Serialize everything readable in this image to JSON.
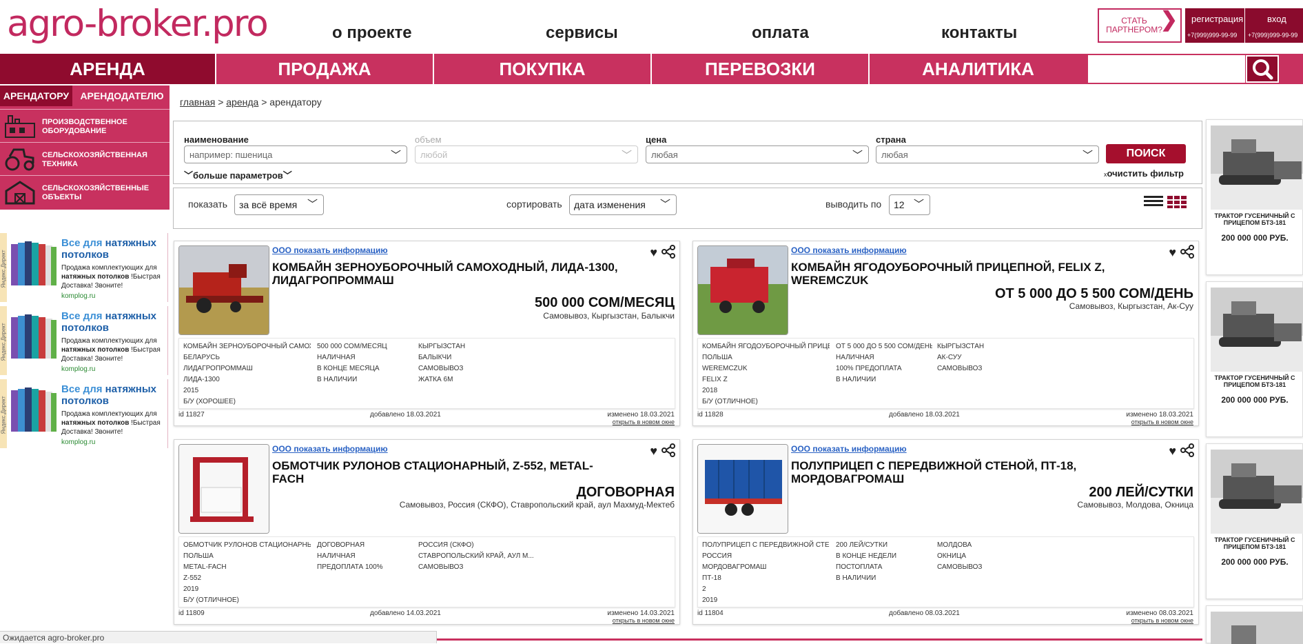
{
  "logo": "agro-broker.pro",
  "topnav": [
    "о проекте",
    "сервисы",
    "оплата",
    "контакты"
  ],
  "partner": {
    "line1": "СТАТЬ",
    "line2": "ПАРТНЕРОМ?",
    "arrow": "❯"
  },
  "auth": {
    "register": "регистрация",
    "login": "вход",
    "phone1": "+7(999)999-99-99",
    "phone2": "+7(999)999-99-99"
  },
  "mainnav": [
    "АРЕНДА",
    "ПРОДАЖА",
    "ПОКУПКА",
    "ПЕРЕВОЗКИ",
    "АНАЛИТИКА"
  ],
  "sidebar": {
    "tabs": [
      "АРЕНДАТОРУ",
      "АРЕНДОДАТЕЛЮ"
    ],
    "items": [
      {
        "l1": "ПРОИЗВОДСТВЕННОЕ",
        "l2": "ОБОРУДОВАНИЕ",
        "icon": "factory-icon"
      },
      {
        "l1": "СЕЛЬСКОХОЗЯЙСТВЕННАЯ",
        "l2": "ТЕХНИКА",
        "icon": "tractor-icon"
      },
      {
        "l1": "СЕЛЬСКОХОЗЯЙСТВЕННЫЕ",
        "l2": "ОБЪЕКТЫ",
        "icon": "barn-icon"
      }
    ]
  },
  "ads": [
    {
      "label": "Яндекс.Директ",
      "t1": "Все для ",
      "t2": "натяжных потолков",
      "d1": "Продажа комплектующих для ",
      "d2": "натяжных потолков",
      "d3": " !Быстрая Доставка! Звоните!",
      "url": "komplog.ru"
    },
    {
      "label": "Яндекс.Директ",
      "t1": "Все для ",
      "t2": "натяжных потолков",
      "d1": "Продажа комплектующих для ",
      "d2": "натяжных потолков",
      "d3": " !Быстрая Доставка! Звоните!",
      "url": "komplog.ru"
    },
    {
      "label": "Яндекс.Директ",
      "t1": "Все для ",
      "t2": "натяжных потолков",
      "d1": "Продажа комплектующих для ",
      "d2": "натяжных потолков",
      "d3": " !Быстрая Доставка! Звоните!",
      "url": "komplog.ru"
    }
  ],
  "breadcrumb": {
    "home": "главная",
    "section": "аренда",
    "current": "арендатору",
    "sep": ">"
  },
  "filter": {
    "name_label": "наименование",
    "name_placeholder": "например: пшеница",
    "volume_label": "объем",
    "volume_value": "любой",
    "price_label": "цена",
    "price_value": "любая",
    "country_label": "страна",
    "country_value": "любая",
    "search": "ПОИСК",
    "more": "больше параметров",
    "clear_x": "x",
    "clear": "очистить фильтр"
  },
  "sortbar": {
    "show_label": "показать",
    "show_value": "за всё время",
    "sort_label": "сортировать",
    "sort_value": "дата изменения",
    "perpage_label": "выводить по",
    "perpage_value": "12"
  },
  "cards": [
    {
      "org": "ООО показать информацию",
      "title": "КОМБАЙН ЗЕРНОУБОРОЧНЫЙ САМОХОДНЫЙ, ЛИДА-1300, ЛИДАГРОПРОММАШ",
      "price": "500 000 СОМ/МЕСЯЦ",
      "location": "Самовывоз, Кыргызстан, Балыкчи",
      "col1": [
        "КОМБАЙН ЗЕРНОУБОРОЧНЫЙ САМОХОДН...",
        "БЕЛАРУСЬ",
        "ЛИДАГРОПРОММАШ",
        "ЛИДА-1300",
        "2015",
        "Б/У (ХОРОШЕЕ)"
      ],
      "col2": [
        "500 000 СОМ/МЕСЯЦ",
        "НАЛИЧНАЯ",
        "В КОНЦЕ МЕСЯЦА",
        "В НАЛИЧИИ"
      ],
      "col3": [
        "КЫРГЫЗСТАН",
        "БАЛЫКЧИ",
        "САМОВЫВОЗ",
        "ЖАТКА 6М"
      ],
      "id": "id 11827",
      "added": "добавлено 18.03.2021",
      "changed": "изменено 18.03.2021",
      "newwin": "открыть в новом окне"
    },
    {
      "org": "ООО показать информацию",
      "title": "КОМБАЙН ЯГОДОУБОРОЧНЫЙ ПРИЦЕПНОЙ, FELIX Z, WEREMCZUK",
      "price": "ОТ 5 000 ДО 5 500 СОМ/ДЕНЬ",
      "location": "Самовывоз, Кыргызстан, Ак-Суу",
      "col1": [
        "КОМБАЙН ЯГОДОУБОРОЧНЫЙ ПРИЦЕПНОЙ",
        "ПОЛЬША",
        "WEREMCZUK",
        "FELIX Z",
        "2018",
        "Б/У (ОТЛИЧНОЕ)"
      ],
      "col2": [
        "ОТ 5 000 ДО 5 500 СОМ/ДЕНЬ",
        "НАЛИЧНАЯ",
        "100% ПРЕДОПЛАТА",
        "В НАЛИЧИИ"
      ],
      "col3": [
        "КЫРГЫЗСТАН",
        "АК-СУУ",
        "САМОВЫВОЗ"
      ],
      "id": "id 11828",
      "added": "добавлено 18.03.2021",
      "changed": "изменено 18.03.2021",
      "newwin": "открыть в новом окне"
    },
    {
      "org": "ООО показать информацию",
      "title": "ОБМОТЧИК РУЛОНОВ СТАЦИОНАРНЫЙ, Z-552, METAL-FACH",
      "price": "ДОГОВОРНАЯ",
      "location": "Самовывоз, Россия (СКФО), Ставропольский край, аул Махмуд-Мектеб",
      "col1": [
        "ОБМОТЧИК РУЛОНОВ СТАЦИОНАРНЫЙ",
        "ПОЛЬША",
        "METAL-FACH",
        "Z-552",
        "2019",
        "Б/У (ОТЛИЧНОЕ)"
      ],
      "col2": [
        "ДОГОВОРНАЯ",
        "НАЛИЧНАЯ",
        "ПРЕДОПЛАТА 100%"
      ],
      "col3": [
        "РОССИЯ (СКФО)",
        "СТАВРОПОЛЬСКИЙ КРАЙ, АУЛ М...",
        "САМОВЫВОЗ"
      ],
      "id": "id 11809",
      "added": "добавлено 14.03.2021",
      "changed": "изменено 14.03.2021",
      "newwin": "открыть в новом окне"
    },
    {
      "org": "ООО показать информацию",
      "title": "ПОЛУПРИЦЕП С ПЕРЕДВИЖНОЙ СТЕНОЙ, ПТ-18, МОРДОВАГРОМАШ",
      "price": "200 ЛЕЙ/СУТКИ",
      "location": "Самовывоз, Молдова, Окница",
      "col1": [
        "ПОЛУПРИЦЕП С ПЕРЕДВИЖНОЙ СТЕНОЙ",
        "РОССИЯ",
        "МОРДОВАГРОМАШ",
        "ПТ-18",
        "2",
        "2019"
      ],
      "col2": [
        "200 ЛЕЙ/СУТКИ",
        "В КОНЦЕ НЕДЕЛИ",
        "ПОСТОПЛАТА",
        "В НАЛИЧИИ"
      ],
      "col3": [
        "МОЛДОВА",
        "ОКНИЦА",
        "САМОВЫВОЗ"
      ],
      "id": "id 11804",
      "added": "добавлено 08.03.2021",
      "changed": "изменено 08.03.2021",
      "newwin": "открыть в новом окне"
    }
  ],
  "right_ads": [
    {
      "title": "ТРАКТОР ГУСЕНИЧНЫЙ С ПРИЦЕПОМ БТЗ-181",
      "price": "200 000 000 РУБ."
    },
    {
      "title": "ТРАКТОР ГУСЕНИЧНЫЙ С ПРИЦЕПОМ БТЗ-181",
      "price": "200 000 000 РУБ."
    },
    {
      "title": "ТРАКТОР ГУСЕНИЧНЫЙ С ПРИЦЕПОМ БТЗ-181",
      "price": "200 000 000 РУБ."
    }
  ],
  "status": "Ожидается agro-broker.pro",
  "colors": {
    "brand": "#c8315f",
    "dark": "#8f0b2e",
    "link": "#2a62c4"
  }
}
